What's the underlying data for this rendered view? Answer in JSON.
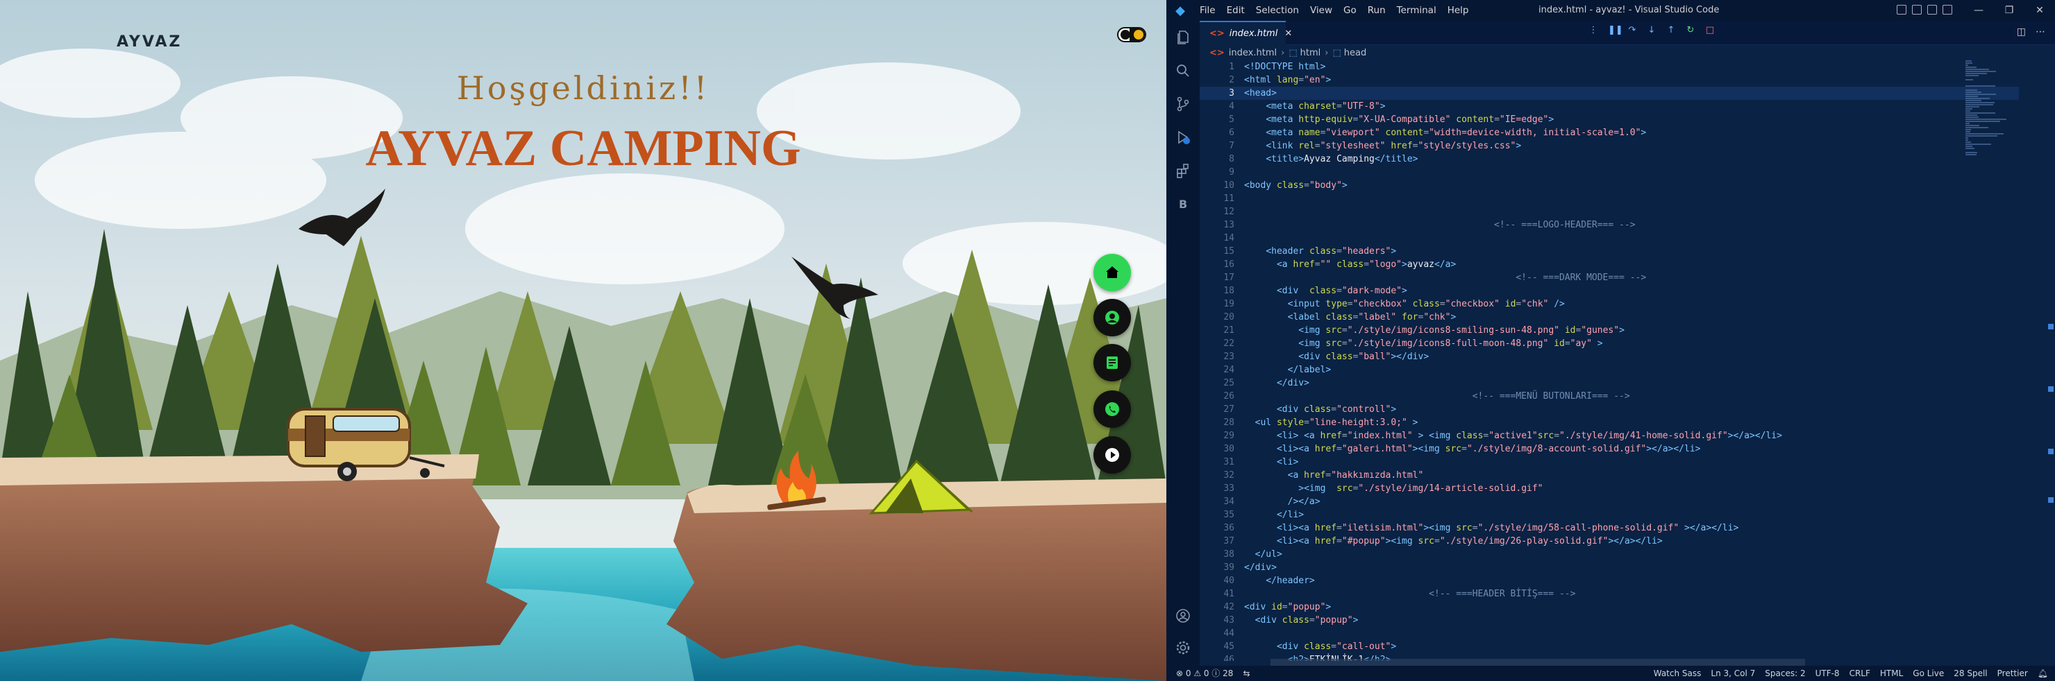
{
  "site": {
    "logo": "AYVAZ",
    "greeting": "Hoşgeldiniz!!",
    "title": "AYVAZ CAMPING",
    "nav": [
      {
        "name": "home",
        "icon": "home-icon",
        "active": true
      },
      {
        "name": "account",
        "icon": "account-icon",
        "active": false
      },
      {
        "name": "article",
        "icon": "article-icon",
        "active": false
      },
      {
        "name": "phone",
        "icon": "phone-icon",
        "active": false
      },
      {
        "name": "play",
        "icon": "play-icon",
        "active": false
      }
    ],
    "colors": {
      "accent": "#2fd655",
      "title": "#c3511a",
      "greeting": "#9f6a28"
    }
  },
  "vscode": {
    "menu": [
      "File",
      "Edit",
      "Selection",
      "View",
      "Go",
      "Run",
      "Terminal",
      "Help"
    ],
    "window_title": "index.html - ayvaz! - Visual Studio Code",
    "tab": {
      "label": "index.html",
      "close": "✕"
    },
    "breadcrumb": [
      "index.html",
      "html",
      "head"
    ],
    "status": {
      "errors": "⊗ 0 ⚠ 0 ⓘ 28",
      "watch": "Watch Sass",
      "position": "Ln 3, Col 7",
      "spaces": "Spaces: 2",
      "encoding": "UTF-8",
      "eol": "CRLF",
      "language": "HTML",
      "golive": "Go Live",
      "spell": "28 Spell",
      "prettier": "Prettier"
    },
    "current_line": 3
  }
}
